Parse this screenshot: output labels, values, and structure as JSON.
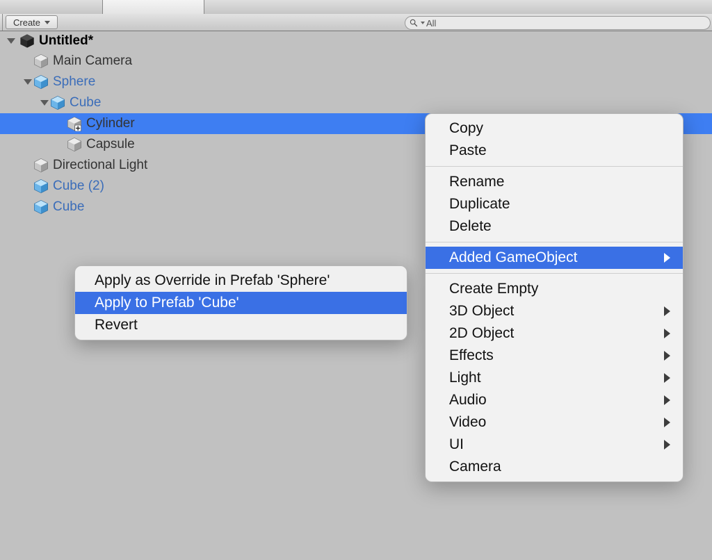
{
  "toolbar": {
    "create_label": "Create",
    "search_placeholder": "All"
  },
  "scene_title": "Untitled*",
  "hierarchy": [
    {
      "label": "Main Camera",
      "indent": 1,
      "prefab": false,
      "expand": false
    },
    {
      "label": "Sphere",
      "indent": 1,
      "prefab": true,
      "expand": true
    },
    {
      "label": "Cube",
      "indent": 2,
      "prefab": true,
      "expand": true
    },
    {
      "label": "Cylinder",
      "indent": 3,
      "prefab": false,
      "selected": true,
      "added": true
    },
    {
      "label": "Capsule",
      "indent": 3,
      "prefab": false
    },
    {
      "label": "Directional Light",
      "indent": 1,
      "prefab": false
    },
    {
      "label": "Cube (2)",
      "indent": 1,
      "prefab": true
    },
    {
      "label": "Cube",
      "indent": 1,
      "prefab": true
    }
  ],
  "submenu": {
    "items": [
      "Apply as Override in Prefab 'Sphere'",
      "Apply to Prefab 'Cube'",
      "Revert"
    ],
    "highlight_index": 1
  },
  "context_menu": {
    "groups": [
      [
        {
          "label": "Copy"
        },
        {
          "label": "Paste"
        }
      ],
      [
        {
          "label": "Rename"
        },
        {
          "label": "Duplicate"
        },
        {
          "label": "Delete"
        }
      ],
      [
        {
          "label": "Added GameObject",
          "has_sub": true,
          "highlight": true
        }
      ],
      [
        {
          "label": "Create Empty"
        },
        {
          "label": "3D Object",
          "has_sub": true
        },
        {
          "label": "2D Object",
          "has_sub": true
        },
        {
          "label": "Effects",
          "has_sub": true
        },
        {
          "label": "Light",
          "has_sub": true
        },
        {
          "label": "Audio",
          "has_sub": true
        },
        {
          "label": "Video",
          "has_sub": true
        },
        {
          "label": "UI",
          "has_sub": true
        },
        {
          "label": "Camera"
        }
      ]
    ]
  }
}
